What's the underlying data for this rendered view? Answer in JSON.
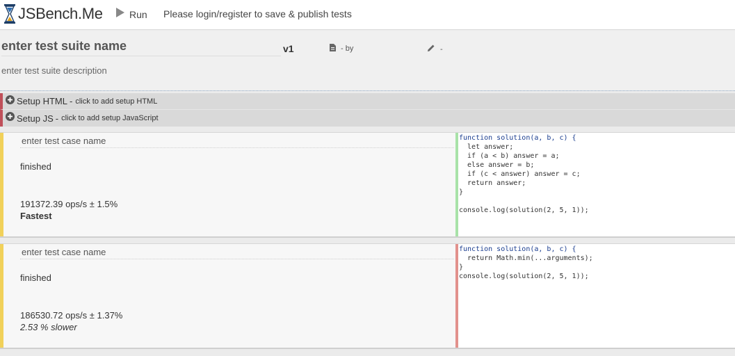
{
  "app": {
    "logo_text": "JSBench.Me",
    "run_label": "Run",
    "nav_message": "Please login/register to save & publish tests"
  },
  "suite": {
    "name_placeholder": "enter test suite name",
    "version": "v1",
    "by_text": "- by",
    "edit_text": "-",
    "description_placeholder": "enter test suite description"
  },
  "setup": {
    "html": {
      "title": "Setup HTML",
      "dash": "-",
      "hint": "click to add setup HTML"
    },
    "js": {
      "title": "Setup JS",
      "dash": "-",
      "hint": "click to add setup JavaScript"
    }
  },
  "cases": [
    {
      "name_placeholder": "enter test case name",
      "status": "finished",
      "ops": "191372.39 ops/s ± 1.5%",
      "rank": "Fastest",
      "code_lines": [
        "function solution(a, b, c) {",
        "  let answer;",
        "  if (a < b) answer = a;",
        "  else answer = b;",
        "  if (c < answer) answer = c;",
        "  return answer;",
        "}",
        "",
        "console.log(solution(2, 5, 1));"
      ]
    },
    {
      "name_placeholder": "enter test case name",
      "status": "finished",
      "ops": "186530.72 ops/s ± 1.37%",
      "rank": "2.53 % slower",
      "code_lines": [
        "function solution(a, b, c) {",
        "  return Math.min(...arguments);",
        "}",
        "console.log(solution(2, 5, 1));"
      ]
    }
  ],
  "colors": {
    "setup_accent": "#c0505a",
    "case_accent": "#f1d15a",
    "fastest_code_border": "#a8e2a8",
    "slower_code_border": "#e2918c"
  },
  "icons": {
    "logo": "hourglass-icon",
    "run": "play-icon",
    "author": "document-icon",
    "edit": "pencil-icon",
    "setup": "plus-circle-icon"
  }
}
